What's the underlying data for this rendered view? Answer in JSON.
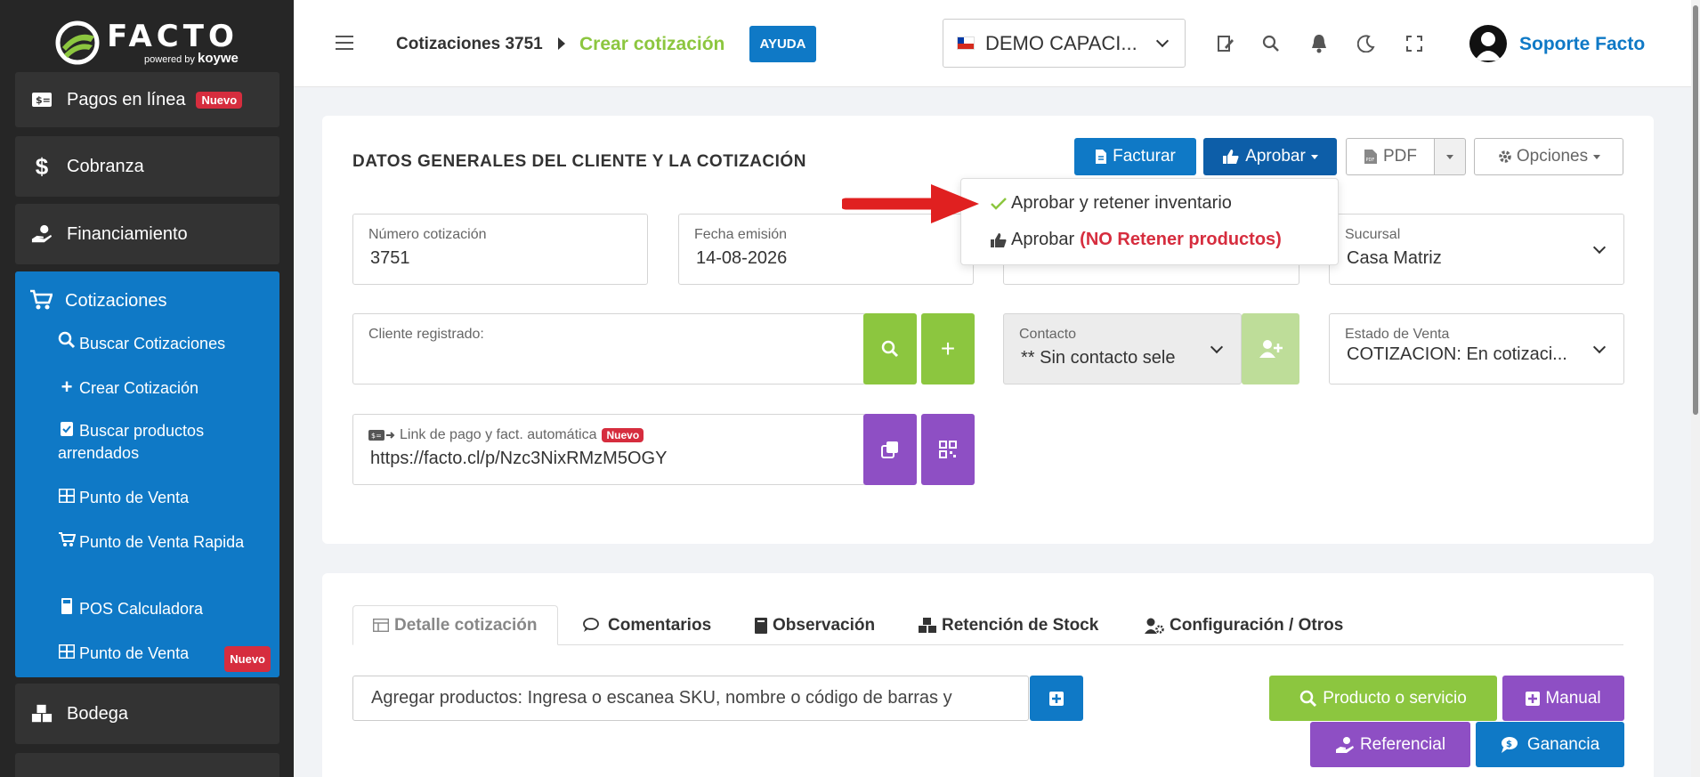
{
  "brand": {
    "name": "FACTO",
    "powered": "powered",
    "by": "by",
    "partner": "koywe"
  },
  "sidebar": {
    "items": [
      {
        "label": "Pagos en línea",
        "badge": "Nuevo"
      },
      {
        "label": "Cobranza"
      },
      {
        "label": "Financiamiento"
      },
      {
        "label": "Cotizaciones"
      },
      {
        "label": "Bodega"
      }
    ],
    "cotizaciones_sub": [
      {
        "label": "Buscar Cotizaciones"
      },
      {
        "label": "Crear Cotización"
      },
      {
        "label": "Buscar productos arrendados"
      },
      {
        "label": "Punto de Venta"
      },
      {
        "label": "Punto de Venta Rapida"
      },
      {
        "label": "POS Calculadora"
      },
      {
        "label": "Punto de Venta",
        "badge": "Nuevo"
      }
    ]
  },
  "topbar": {
    "breadcrumb_parent": "Cotizaciones 3751",
    "breadcrumb_current": "Crear cotización",
    "help": "AYUDA",
    "company": "DEMO CAPACI...",
    "user": "Soporte Facto"
  },
  "header": {
    "title": "DATOS GENERALES DEL CLIENTE Y LA COTIZACIÓN",
    "facturar": "Facturar",
    "aprobar": "Aprobar",
    "pdf": "PDF",
    "opciones": "Opciones"
  },
  "dropdown": {
    "item1": "Aprobar y retener inventario",
    "item2_prefix": "Aprobar",
    "item2_highlight": "(NO Retener productos)"
  },
  "form": {
    "numero": {
      "label": "Número cotización",
      "value": "3751"
    },
    "fecha": {
      "label": "Fecha emisión",
      "value": "14-08-2026"
    },
    "sucursal": {
      "label": "Sucursal",
      "value": "Casa Matriz"
    },
    "cliente": {
      "label": "Cliente registrado:",
      "value": ""
    },
    "contacto": {
      "label": "Contacto",
      "value": "** Sin contacto sele"
    },
    "estado": {
      "label": "Estado de Venta",
      "value": "COTIZACION: En cotizaci..."
    },
    "link": {
      "label": "Link de pago y fact. automática",
      "badge": "Nuevo",
      "value": "https://facto.cl/p/Nzc3NixRMzM5OGY"
    }
  },
  "tabs": [
    {
      "label": "Detalle cotización"
    },
    {
      "label": "Comentarios"
    },
    {
      "label": "Observación"
    },
    {
      "label": "Retención de Stock"
    },
    {
      "label": "Configuración / Otros"
    }
  ],
  "products": {
    "placeholder": "Agregar productos: Ingresa o escanea SKU, nombre o código de barras y",
    "producto_servicio": "Producto o servicio",
    "manual": "Manual",
    "referencial": "Referencial",
    "ganancia": "Ganancia"
  },
  "colors": {
    "primary": "#0f79c6",
    "green": "#8cc63f",
    "purple": "#8e4fc4",
    "red": "#d62d3e",
    "sidebar": "#262626"
  }
}
